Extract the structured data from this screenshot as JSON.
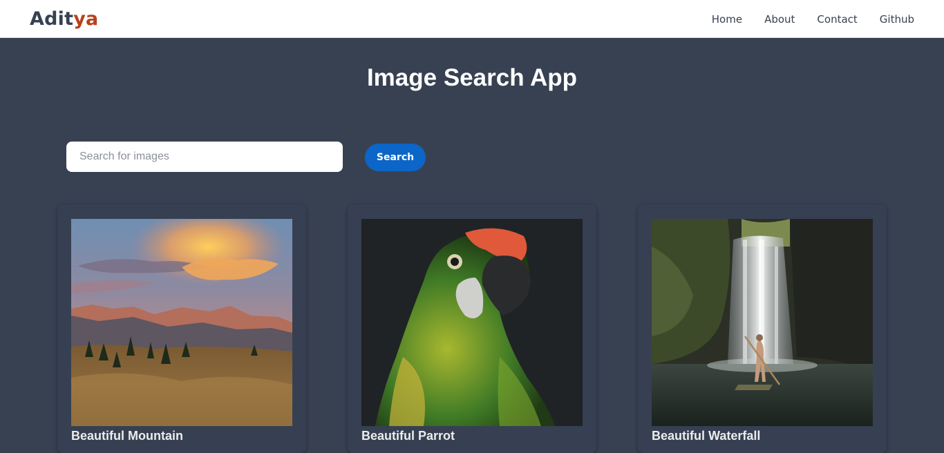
{
  "navbar": {
    "brand_part1": "Adit",
    "brand_part2": "ya",
    "links": [
      {
        "label": "Home"
      },
      {
        "label": "About"
      },
      {
        "label": "Contact"
      },
      {
        "label": "Github"
      }
    ]
  },
  "main": {
    "title": "Image Search App",
    "search": {
      "placeholder": "Search for images",
      "value": "",
      "button_label": "Search"
    },
    "cards": [
      {
        "title": "Beautiful Mountain"
      },
      {
        "title": "Beautiful Parrot"
      },
      {
        "title": "Beautiful Waterfall"
      }
    ]
  },
  "colors": {
    "background": "#384152",
    "brand_dark": "#374151",
    "brand_accent": "#b8411d",
    "button": "#0b66c8"
  }
}
